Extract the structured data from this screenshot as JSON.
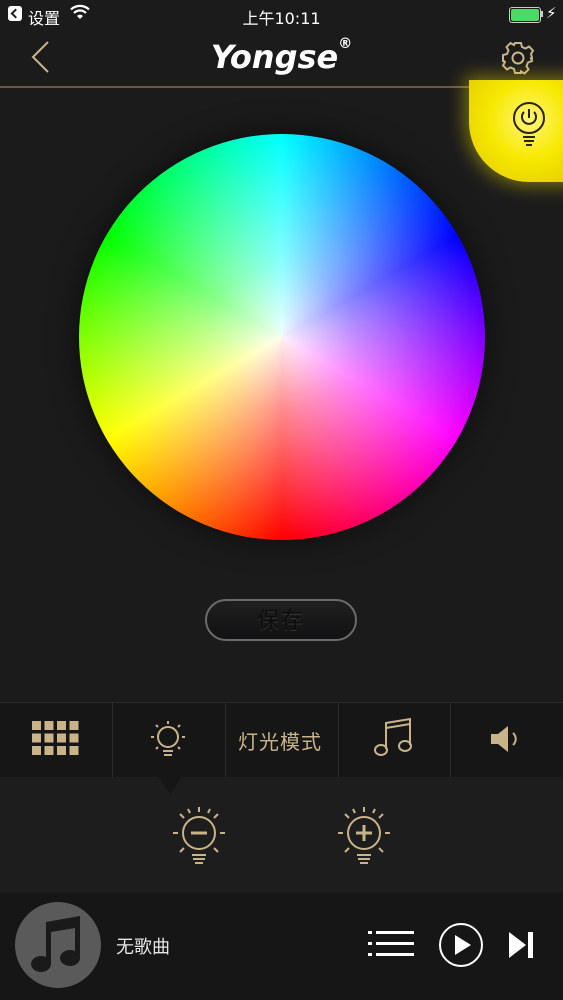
{
  "status_bar": {
    "app_name": "设置",
    "time": "上午10:11",
    "battery_level": 1.0,
    "wifi_icon": "wifi-icon",
    "charging_icon": "lightning-icon"
  },
  "header": {
    "logo_text": "Yongse",
    "logo_mark": "®",
    "back_icon": "chevron-left-icon",
    "settings_icon": "gear-icon"
  },
  "power_button": {
    "icon": "power-bulb-icon",
    "color": "#f7e900"
  },
  "color_wheel": {
    "type": "hue-saturation"
  },
  "save_label": "保存",
  "tabs": [
    {
      "icon": "grid-icon",
      "label": ""
    },
    {
      "icon": "light-bulb-icon",
      "label": ""
    },
    {
      "icon": "",
      "label": "灯光模式"
    },
    {
      "icon": "music-note-icon",
      "label": ""
    },
    {
      "icon": "speaker-icon",
      "label": ""
    }
  ],
  "brightness": {
    "decrease_icon": "bulb-minus-icon",
    "increase_icon": "bulb-plus-icon"
  },
  "player": {
    "song": "无歌曲",
    "album_icon": "music-note-icon",
    "playlist_icon": "list-icon",
    "play_icon": "play-icon",
    "next_icon": "skip-next-icon"
  },
  "colors": {
    "accent": "#c9b48a",
    "background": "#1b1b1c"
  }
}
